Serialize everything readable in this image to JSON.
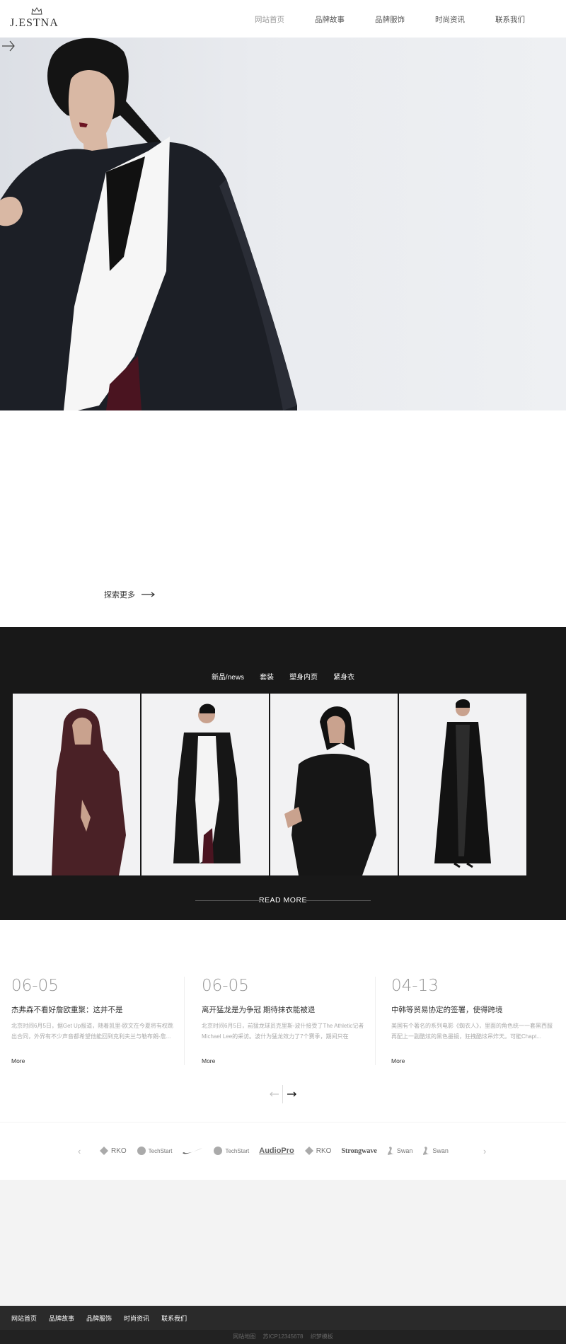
{
  "header": {
    "logo_text": "J.ESTNA",
    "nav": [
      {
        "label": "网站首页",
        "active": true
      },
      {
        "label": "品牌故事",
        "active": false
      },
      {
        "label": "品牌服饰",
        "active": false
      },
      {
        "label": "时尚资讯",
        "active": false
      },
      {
        "label": "联系我们",
        "active": false
      }
    ]
  },
  "hero": {
    "next_icon": "arrow-right-icon"
  },
  "explore": {
    "label": "探索更多",
    "icon": "long-arrow-right-icon"
  },
  "products": {
    "tabs": [
      "新品/news",
      "套装",
      "塑身内页",
      "紧身衣"
    ],
    "items": [
      {
        "name": "burgundy-hooded-coat"
      },
      {
        "name": "black-white-long-coat"
      },
      {
        "name": "black-blazer-look"
      },
      {
        "name": "black-long-trench"
      }
    ],
    "read_more": "READ MORE"
  },
  "news": {
    "items": [
      {
        "date": "06-05",
        "title": "杰弗森不看好詹欧重聚：这并不是",
        "desc": "北京时间6月5日，据Get Up报道，随着凯里-欧文在今夏将有权跳出合同，外界有不少声音都希望他能回到克利夫兰与勒布朗-詹...",
        "more": "More"
      },
      {
        "date": "06-05",
        "title": "离开猛龙是为争冠 期待抹衣能被退",
        "desc": "北京时间6月5日，前猛龙球员克里斯-波什接受了The Athletic记者Michael Lee的采访。波什为猛龙效力了7个赛季，期间只在2006...",
        "more": "More"
      },
      {
        "date": "04-13",
        "title": "中韩等贸易协定的签署，使得跨境",
        "desc": "美国有个著名的系列电影《蜘衣人》，里面的角色统一一套黑西服再配上一副酷炫的黑色墨镜，狂拽酷炫吊炸天。可能Chapt...",
        "more": "More"
      }
    ]
  },
  "pager": {
    "prev_icon": "arrow-left-icon",
    "next_icon": "arrow-right-icon"
  },
  "partners": {
    "logos": [
      "RKO",
      "TechStart",
      "Nike",
      "TechStart",
      "AudioPro",
      "RKO",
      "Strongwave",
      "Swan",
      "Swan"
    ]
  },
  "footer": {
    "nav": [
      "网站首页",
      "品牌故事",
      "品牌服饰",
      "时尚资讯",
      "联系我们"
    ],
    "copy": [
      "网站地图",
      "苏ICP12345678",
      "织梦模板"
    ]
  }
}
